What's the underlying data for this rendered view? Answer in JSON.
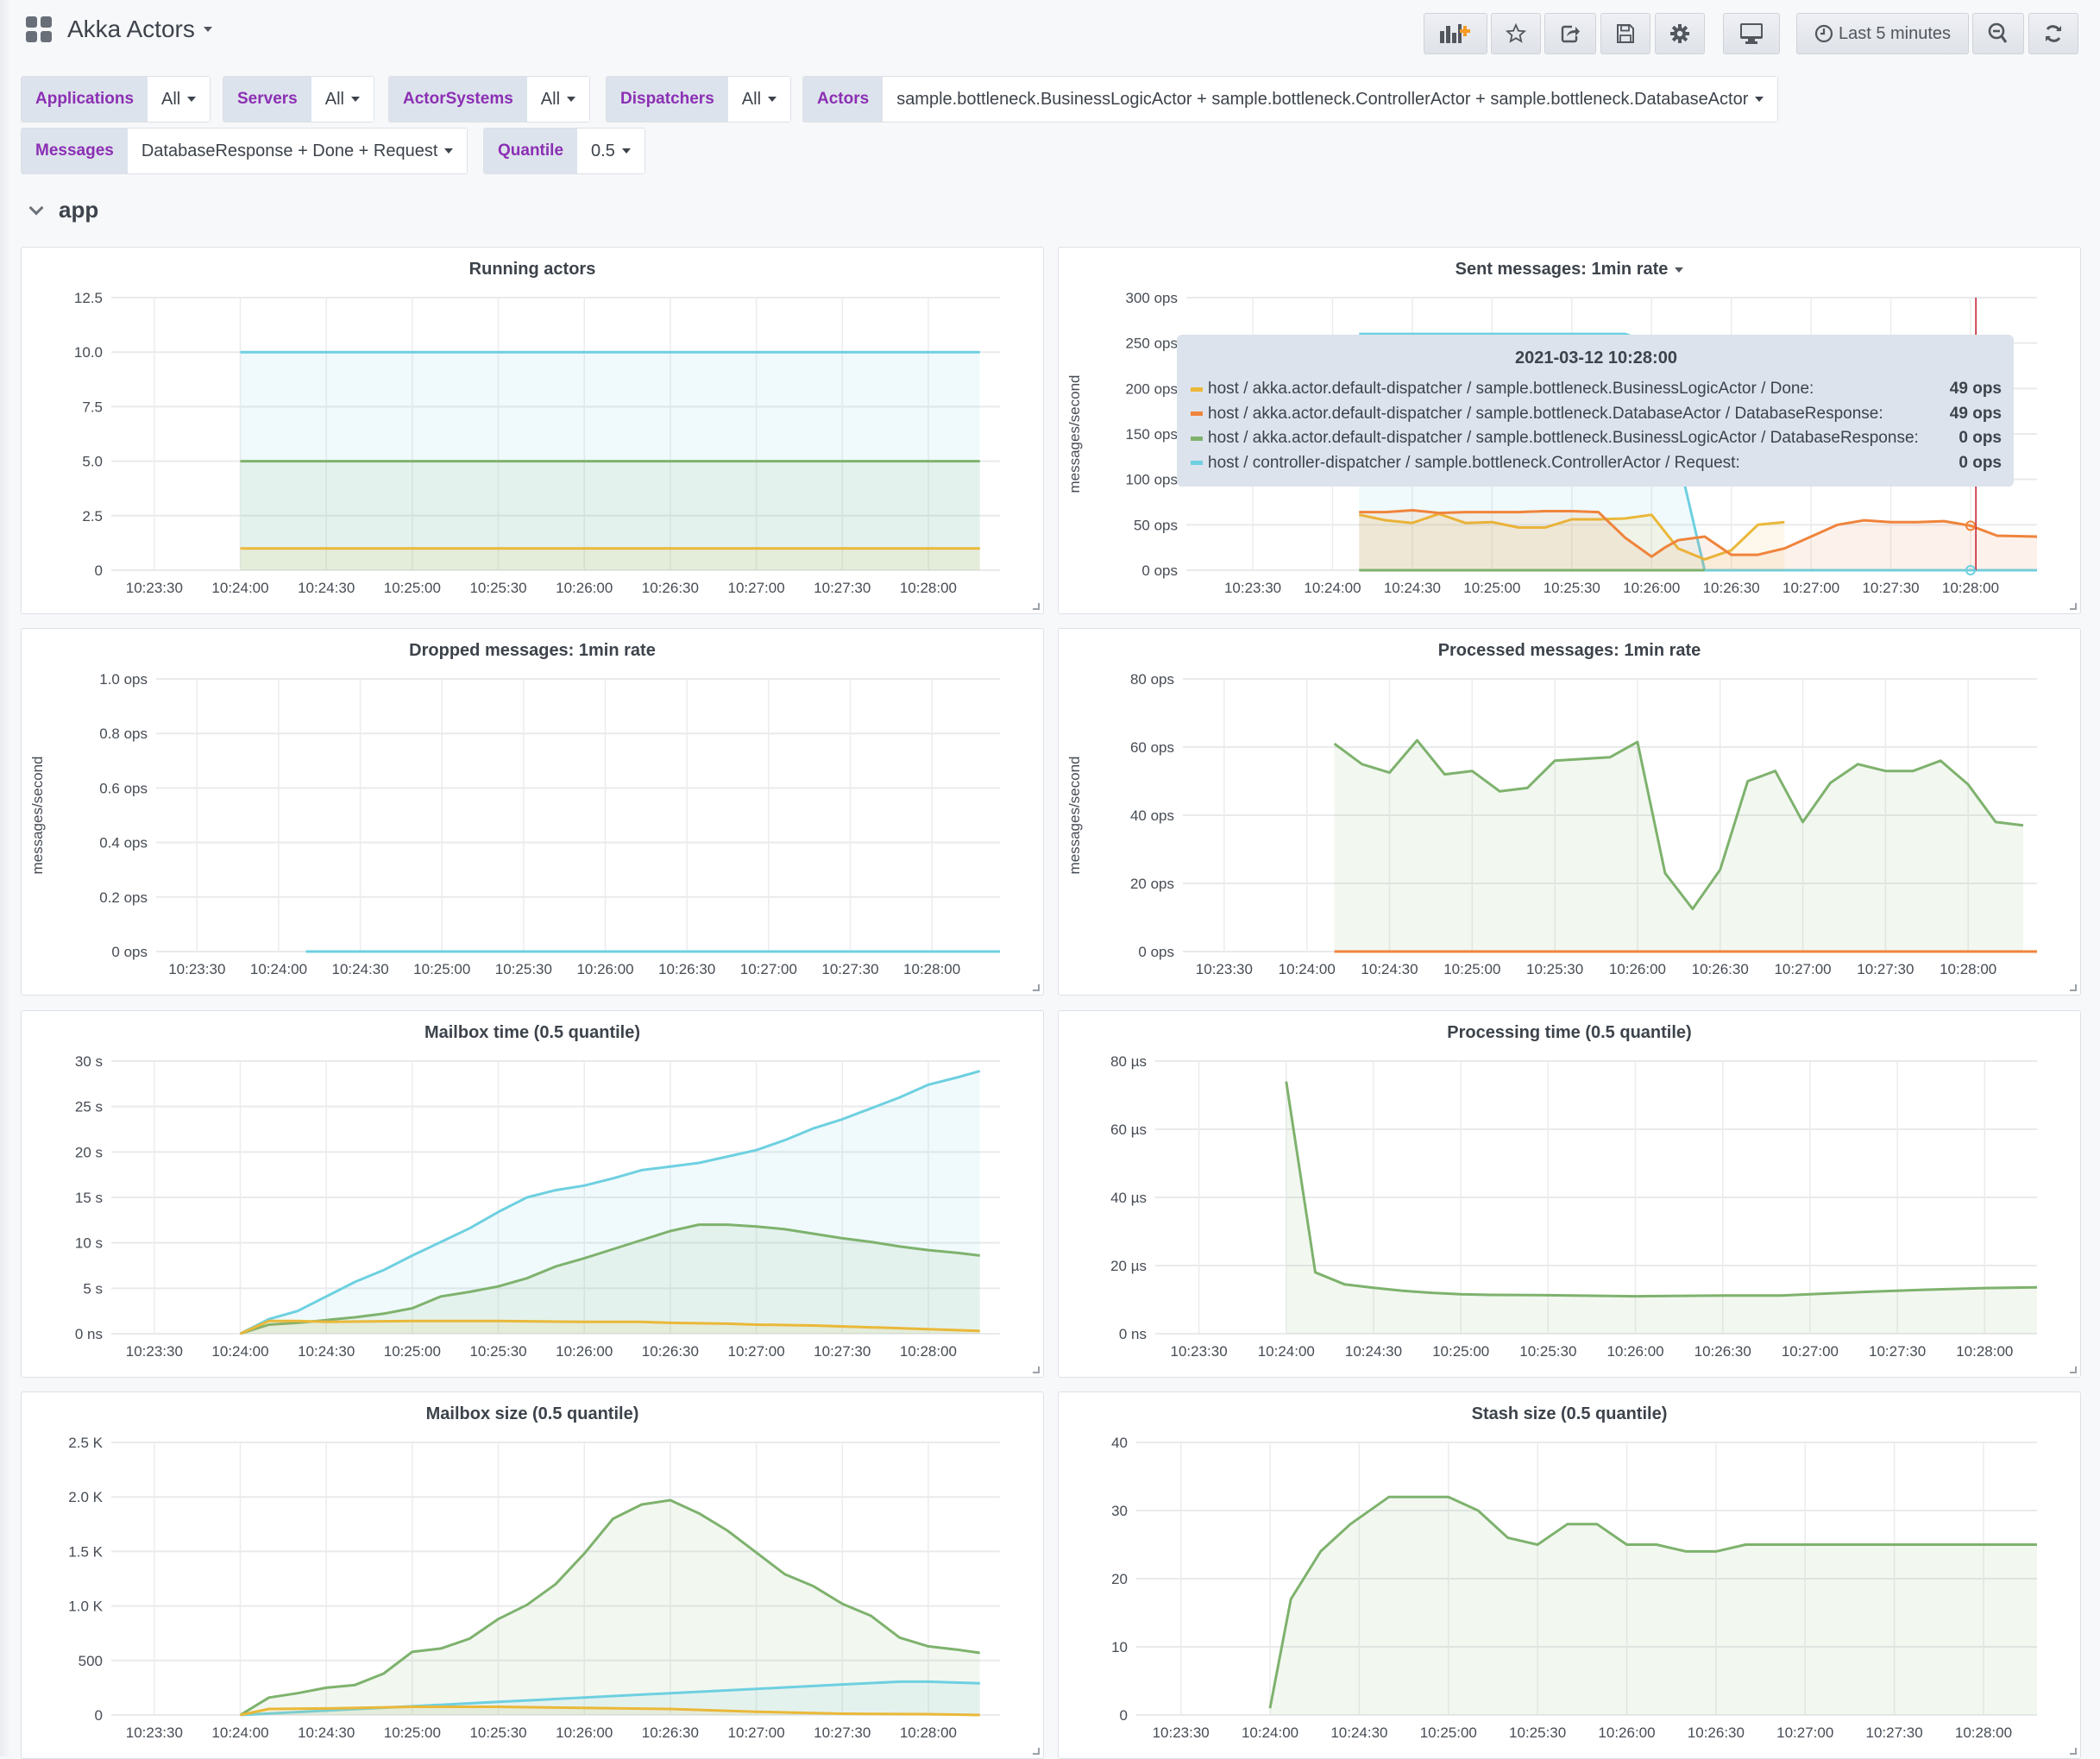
{
  "header": {
    "title": "Akka Actors",
    "time_range": "Last 5 minutes",
    "buttons": [
      "add-panel",
      "star",
      "share",
      "save",
      "settings",
      "tv-mode",
      "time-range",
      "zoom-out",
      "refresh"
    ]
  },
  "variables": [
    {
      "label": "Applications",
      "value": "All"
    },
    {
      "label": "Servers",
      "value": "All"
    },
    {
      "label": "ActorSystems",
      "value": "All"
    },
    {
      "label": "Dispatchers",
      "value": "All"
    },
    {
      "label": "Actors",
      "value": "sample.bottleneck.BusinessLogicActor + sample.bottleneck.ControllerActor + sample.bottleneck.DatabaseActor"
    },
    {
      "label": "Messages",
      "value": "DatabaseResponse + Done + Request"
    },
    {
      "label": "Quantile",
      "value": "0.5"
    }
  ],
  "row": {
    "title": "app"
  },
  "colors": {
    "yellow": "#eab839",
    "orange": "#ef843c",
    "green": "#7eb26d",
    "cyan": "#6ed0e0",
    "red": "#c4162a"
  },
  "tooltip": {
    "time": "2021-03-12 10:28:00",
    "rows": [
      {
        "color": "#eab839",
        "name": "host / akka.actor.default-dispatcher / sample.bottleneck.BusinessLogicActor / Done:",
        "value": "49 ops"
      },
      {
        "color": "#ef843c",
        "name": "host / akka.actor.default-dispatcher / sample.bottleneck.DatabaseActor / DatabaseResponse:",
        "value": "49 ops"
      },
      {
        "color": "#7eb26d",
        "name": "host / akka.actor.default-dispatcher / sample.bottleneck.BusinessLogicActor / DatabaseResponse:",
        "value": "0 ops"
      },
      {
        "color": "#6ed0e0",
        "name": "host / controller-dispatcher / sample.bottleneck.ControllerActor / Request:",
        "value": "0 ops"
      }
    ]
  },
  "chart_data": [
    {
      "id": "running-actors",
      "type": "area",
      "title": "Running actors",
      "ylabel": "",
      "ylim": [
        0,
        12.5
      ],
      "yticks": [
        "0",
        "2.5",
        "5.0",
        "7.5",
        "10.0",
        "12.5"
      ],
      "ytick_values": [
        0,
        2.5,
        5,
        7.5,
        10,
        12.5
      ],
      "xticks": [
        "10:23:30",
        "10:24:00",
        "10:24:30",
        "10:25:00",
        "10:25:30",
        "10:26:00",
        "10:26:30",
        "10:27:00",
        "10:27:30",
        "10:28:00"
      ],
      "xlim_seconds": [
        -45,
        265
      ],
      "series": [
        {
          "name": "cyan",
          "color": "#6ed0e0",
          "x": [
            0,
            258
          ],
          "values": [
            10,
            10
          ]
        },
        {
          "name": "green",
          "color": "#7eb26d",
          "x": [
            0,
            258
          ],
          "values": [
            5,
            5
          ]
        },
        {
          "name": "yellow",
          "color": "#eab839",
          "x": [
            0,
            258
          ],
          "values": [
            1,
            1
          ]
        }
      ]
    },
    {
      "id": "sent-messages",
      "type": "area",
      "title": "Sent messages: 1min rate",
      "has_menu": true,
      "ylabel": "messages/second",
      "ylim": [
        0,
        300
      ],
      "yticks": [
        "0 ops",
        "50 ops",
        "100 ops",
        "150 ops",
        "200 ops",
        "250 ops",
        "300 ops"
      ],
      "ytick_values": [
        0,
        50,
        100,
        150,
        200,
        250,
        300
      ],
      "xticks": [
        "10:23:30",
        "10:24:00",
        "10:24:30",
        "10:25:00",
        "10:25:30",
        "10:26:00",
        "10:26:30",
        "10:27:00",
        "10:27:30",
        "10:28:00"
      ],
      "xlim_seconds": [
        -55,
        265
      ],
      "crosshair_seconds": 242,
      "series": [
        {
          "name": "host / controller-dispatcher / sample.bottleneck.ControllerActor / Request",
          "color": "#6ed0e0",
          "x": [
            10,
            110,
            120,
            140,
            160,
            180,
            200,
            220,
            240,
            265
          ],
          "values": [
            260,
            260,
            250,
            0,
            0,
            0,
            0,
            0,
            0,
            0
          ]
        },
        {
          "name": "host / akka.actor.default-dispatcher / sample.bottleneck.BusinessLogicActor / Done",
          "color": "#eab839",
          "x": [
            10,
            20,
            30,
            40,
            50,
            60,
            70,
            80,
            90,
            100,
            110,
            120,
            130,
            140,
            150,
            160,
            170
          ],
          "values": [
            61,
            55,
            52,
            62,
            52,
            53,
            47,
            47,
            56,
            56,
            57,
            61,
            24,
            12,
            22,
            50,
            53
          ]
        },
        {
          "name": "host / akka.actor.default-dispatcher / sample.bottleneck.DatabaseActor / DatabaseResponse",
          "color": "#ef843c",
          "x": [
            10,
            20,
            30,
            40,
            50,
            60,
            70,
            80,
            90,
            100,
            110,
            120,
            125,
            130,
            140,
            150,
            160,
            170,
            180,
            190,
            200,
            210,
            220,
            230,
            240,
            250,
            265
          ],
          "values": [
            64,
            64,
            66,
            63,
            64,
            64,
            64,
            65,
            65,
            64,
            36,
            15,
            25,
            33,
            37,
            17,
            17,
            24,
            37,
            50,
            55,
            53,
            53,
            54,
            49,
            38,
            37
          ]
        },
        {
          "name": "host / akka.actor.default-dispatcher / sample.bottleneck.BusinessLogicActor / DatabaseResponse",
          "color": "#7eb26d",
          "x": [
            10,
            140
          ],
          "values": [
            0,
            0
          ]
        }
      ]
    },
    {
      "id": "dropped-messages",
      "type": "line",
      "title": "Dropped messages: 1min rate",
      "ylabel": "messages/second",
      "ylim": [
        0,
        1.0
      ],
      "yticks": [
        "0 ops",
        "0.2 ops",
        "0.4 ops",
        "0.6 ops",
        "0.8 ops",
        "1.0 ops"
      ],
      "ytick_values": [
        0,
        0.2,
        0.4,
        0.6,
        0.8,
        1.0
      ],
      "xticks": [
        "10:23:30",
        "10:24:00",
        "10:24:30",
        "10:25:00",
        "10:25:30",
        "10:26:00",
        "10:26:30",
        "10:27:00",
        "10:27:30",
        "10:28:00"
      ],
      "xlim_seconds": [
        -45,
        265
      ],
      "series": [
        {
          "name": "cyan",
          "color": "#6ed0e0",
          "x": [
            10,
            265
          ],
          "values": [
            0,
            0
          ]
        }
      ]
    },
    {
      "id": "processed-messages",
      "type": "area",
      "title": "Processed messages: 1min rate",
      "ylabel": "messages/second",
      "ylim": [
        0,
        80
      ],
      "yticks": [
        "0 ops",
        "20 ops",
        "40 ops",
        "60 ops",
        "80 ops"
      ],
      "ytick_values": [
        0,
        20,
        40,
        60,
        80
      ],
      "xticks": [
        "10:23:30",
        "10:24:00",
        "10:24:30",
        "10:25:00",
        "10:25:30",
        "10:26:00",
        "10:26:30",
        "10:27:00",
        "10:27:30",
        "10:28:00"
      ],
      "xlim_seconds": [
        -45,
        265
      ],
      "series": [
        {
          "name": "green",
          "color": "#7eb26d",
          "x": [
            10,
            20,
            30,
            40,
            50,
            60,
            70,
            80,
            90,
            100,
            110,
            120,
            130,
            140,
            150,
            160,
            170,
            180,
            190,
            200,
            210,
            220,
            230,
            240,
            250,
            260
          ],
          "values": [
            61,
            55,
            52.5,
            62,
            52,
            53,
            47,
            48,
            56,
            56.5,
            57,
            61.5,
            23,
            12.5,
            24,
            50,
            53,
            38,
            49.5,
            55,
            53,
            53,
            56,
            49,
            38,
            37
          ]
        },
        {
          "name": "orange",
          "color": "#ef843c",
          "x": [
            10,
            265
          ],
          "values": [
            0,
            0
          ]
        }
      ]
    },
    {
      "id": "mailbox-time",
      "type": "area",
      "title": "Mailbox time (0.5 quantile)",
      "ylabel": "",
      "ylim": [
        0,
        30
      ],
      "yticks": [
        "0 ns",
        "5 s",
        "10 s",
        "15 s",
        "20 s",
        "25 s",
        "30 s"
      ],
      "ytick_values": [
        0,
        5,
        10,
        15,
        20,
        25,
        30
      ],
      "xticks": [
        "10:23:30",
        "10:24:00",
        "10:24:30",
        "10:25:00",
        "10:25:30",
        "10:26:00",
        "10:26:30",
        "10:27:00",
        "10:27:30",
        "10:28:00"
      ],
      "xlim_seconds": [
        -45,
        265
      ],
      "series": [
        {
          "name": "cyan",
          "color": "#6ed0e0",
          "x": [
            0,
            10,
            20,
            30,
            40,
            50,
            60,
            70,
            80,
            90,
            100,
            110,
            120,
            130,
            140,
            150,
            160,
            170,
            180,
            190,
            200,
            210,
            220,
            230,
            240,
            250,
            258
          ],
          "values": [
            0,
            1.6,
            2.5,
            4.1,
            5.7,
            7.0,
            8.6,
            10.1,
            11.6,
            13.4,
            15.0,
            15.8,
            16.3,
            17.1,
            18.0,
            18.4,
            18.8,
            19.5,
            20.2,
            21.3,
            22.6,
            23.6,
            24.8,
            26.0,
            27.4,
            28.2,
            28.9
          ]
        },
        {
          "name": "green",
          "color": "#7eb26d",
          "x": [
            0,
            10,
            20,
            30,
            40,
            50,
            60,
            70,
            80,
            90,
            100,
            110,
            120,
            130,
            140,
            150,
            160,
            170,
            180,
            190,
            200,
            210,
            220,
            230,
            240,
            250,
            258
          ],
          "values": [
            0,
            1.0,
            1.2,
            1.5,
            1.8,
            2.2,
            2.8,
            4.1,
            4.6,
            5.2,
            6.1,
            7.4,
            8.3,
            9.3,
            10.3,
            11.3,
            12.0,
            12.0,
            11.8,
            11.5,
            11.0,
            10.5,
            10.1,
            9.6,
            9.2,
            8.9,
            8.6
          ]
        },
        {
          "name": "yellow",
          "color": "#eab839",
          "x": [
            0,
            10,
            20,
            30,
            60,
            90,
            120,
            140,
            150,
            170,
            180,
            200,
            220,
            240,
            258
          ],
          "values": [
            0,
            1.4,
            1.4,
            1.3,
            1.4,
            1.4,
            1.3,
            1.3,
            1.2,
            1.1,
            1.0,
            0.9,
            0.7,
            0.5,
            0.3
          ]
        }
      ]
    },
    {
      "id": "processing-time",
      "type": "area",
      "title": "Processing time (0.5 quantile)",
      "ylabel": "",
      "ylim": [
        0,
        80
      ],
      "yticks": [
        "0 ns",
        "20 µs",
        "40 µs",
        "60 µs",
        "80 µs"
      ],
      "ytick_values": [
        0,
        20,
        40,
        60,
        80
      ],
      "xticks": [
        "10:23:30",
        "10:24:00",
        "10:24:30",
        "10:25:00",
        "10:25:30",
        "10:26:00",
        "10:26:30",
        "10:27:00",
        "10:27:30",
        "10:28:00"
      ],
      "xlim_seconds": [
        -45,
        258
      ],
      "series": [
        {
          "name": "green",
          "color": "#7eb26d",
          "x": [
            0,
            10,
            20,
            30,
            40,
            50,
            60,
            70,
            90,
            120,
            150,
            170,
            180,
            200,
            220,
            240,
            258
          ],
          "values": [
            74,
            18,
            14.5,
            13.5,
            12.6,
            12.0,
            11.6,
            11.4,
            11.3,
            11.0,
            11.2,
            11.2,
            11.6,
            12.3,
            12.9,
            13.4,
            13.6
          ]
        }
      ]
    },
    {
      "id": "mailbox-size",
      "type": "area",
      "title": "Mailbox size (0.5 quantile)",
      "ylabel": "",
      "ylim": [
        0,
        2500
      ],
      "yticks": [
        "0",
        "500",
        "1.0 K",
        "1.5 K",
        "2.0 K",
        "2.5 K"
      ],
      "ytick_values": [
        0,
        500,
        1000,
        1500,
        2000,
        2500
      ],
      "xticks": [
        "10:23:30",
        "10:24:00",
        "10:24:30",
        "10:25:00",
        "10:25:30",
        "10:26:00",
        "10:26:30",
        "10:27:00",
        "10:27:30",
        "10:28:00"
      ],
      "xlim_seconds": [
        -45,
        265
      ],
      "series": [
        {
          "name": "green",
          "color": "#7eb26d",
          "x": [
            0,
            10,
            20,
            30,
            40,
            50,
            60,
            70,
            80,
            90,
            100,
            110,
            120,
            130,
            140,
            150,
            160,
            170,
            180,
            190,
            200,
            210,
            220,
            230,
            240,
            250,
            258
          ],
          "values": [
            0,
            160,
            200,
            250,
            275,
            380,
            580,
            610,
            700,
            880,
            1010,
            1200,
            1480,
            1800,
            1930,
            1970,
            1850,
            1690,
            1490,
            1290,
            1180,
            1020,
            910,
            710,
            630,
            600,
            570
          ]
        },
        {
          "name": "cyan",
          "color": "#6ed0e0",
          "x": [
            0,
            30,
            60,
            90,
            120,
            150,
            180,
            210,
            230,
            240,
            258
          ],
          "values": [
            0,
            40,
            80,
            120,
            160,
            200,
            240,
            280,
            305,
            305,
            290
          ]
        },
        {
          "name": "yellow",
          "color": "#eab839",
          "x": [
            0,
            10,
            30,
            60,
            90,
            120,
            150,
            180,
            210,
            240,
            258
          ],
          "values": [
            0,
            55,
            60,
            75,
            75,
            65,
            55,
            30,
            12,
            8,
            0
          ]
        }
      ]
    },
    {
      "id": "stash-size",
      "type": "area",
      "title": "Stash size (0.5 quantile)",
      "ylabel": "",
      "ylim": [
        0,
        40
      ],
      "yticks": [
        "0",
        "10",
        "20",
        "30",
        "40"
      ],
      "ytick_values": [
        0,
        10,
        20,
        30,
        40
      ],
      "xticks": [
        "10:23:30",
        "10:24:00",
        "10:24:30",
        "10:25:00",
        "10:25:30",
        "10:26:00",
        "10:26:30",
        "10:27:00",
        "10:27:30",
        "10:28:00"
      ],
      "xlim_seconds": [
        -45,
        258
      ],
      "series": [
        {
          "name": "green",
          "color": "#7eb26d",
          "x": [
            0,
            7,
            17,
            27,
            40,
            60,
            70,
            80,
            90,
            100,
            110,
            120,
            130,
            140,
            150,
            160,
            258
          ],
          "values": [
            1,
            17,
            24,
            28,
            32,
            32,
            30,
            26,
            25,
            28,
            28,
            25,
            25,
            24,
            24,
            25,
            25
          ]
        }
      ]
    }
  ]
}
